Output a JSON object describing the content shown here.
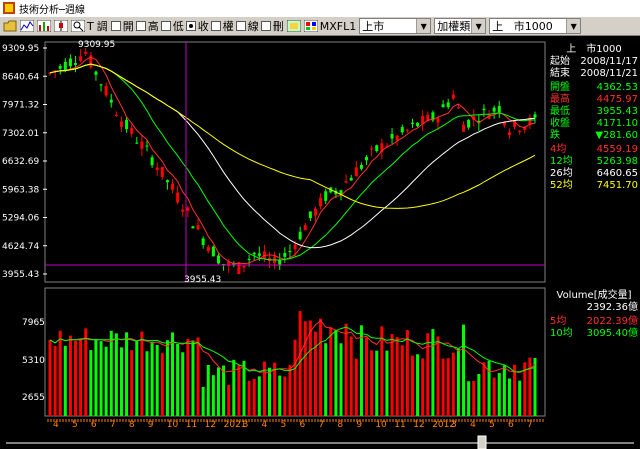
{
  "window": {
    "title": "技術分析─週線"
  },
  "toolbar": {
    "t_label": "T",
    "checks": [
      "開",
      "高",
      "低",
      "收",
      "權",
      "線",
      "刪"
    ],
    "checked": "收",
    "symbol_text": "MXFL1",
    "market_select": "上市",
    "rights_select": "加權類",
    "index_select_prefix": "上",
    "index_select_value": "市1000",
    "t_after": "調"
  },
  "colors": {
    "up": "#ff0000",
    "down": "#00ff00",
    "ma4": "#ff3030",
    "ma12": "#00ff00",
    "ma26": "#ffffff",
    "ma52": "#ffff00",
    "axis": "#c0c0c0",
    "marker": "#c000c0"
  },
  "price_axis": {
    "labels": [
      "9309.95",
      "8640.64",
      "7971.32",
      "7302.01",
      "6632.69",
      "5963.38",
      "5294.06",
      "4624.74",
      "3955.43"
    ]
  },
  "price_annotations": {
    "high": "9309.95",
    "low": "3955.43"
  },
  "volume_axis": {
    "labels": [
      "7965",
      "5310",
      "2655"
    ]
  },
  "x_axis": {
    "labels": [
      "4",
      "5",
      "6",
      "7",
      "8",
      "9",
      "10",
      "11",
      "12",
      "2021",
      "3",
      "4",
      "5",
      "6",
      "7",
      "8",
      "9",
      "10",
      "11",
      "12",
      "2012",
      "3",
      "4",
      "5",
      "6",
      "7"
    ]
  },
  "info": {
    "name": "上　市1000",
    "start_label": "起始",
    "start_value": "2008/11/17",
    "end_label": "結束",
    "end_value": "2008/11/21",
    "open_label": "開盤",
    "open_value": "4362.53",
    "high_label": "最高",
    "high_value": "4475.97",
    "low_label": "最低",
    "low_value": "3955.43",
    "close_label": "收盤",
    "close_value": "4171.10",
    "change_label": "跌",
    "change_value": "▼281.60",
    "ma4_label": "4均",
    "ma4_value": "4559.19",
    "ma12_label": "12均",
    "ma12_value": "5263.98",
    "ma26_label": "26均",
    "ma26_value": "6460.65",
    "ma52_label": "52均",
    "ma52_value": "7451.70"
  },
  "volume_info": {
    "title": "Volume[成交量]",
    "vol_value": "2392.36億",
    "ma5_label": "5均",
    "ma5_value": "2022.39億",
    "ma10_label": "10均",
    "ma10_value": "3095.40億"
  }
}
